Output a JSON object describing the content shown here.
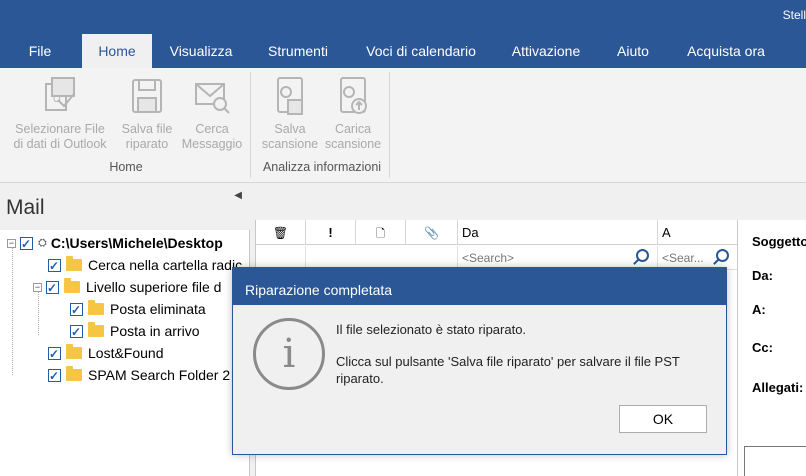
{
  "window": {
    "app_title": "Stell"
  },
  "tabs": [
    {
      "label": "File"
    },
    {
      "label": "Home"
    },
    {
      "label": "Visualizza"
    },
    {
      "label": "Strumenti"
    },
    {
      "label": "Voci di calendario"
    },
    {
      "label": "Attivazione"
    },
    {
      "label": "Aiuto"
    },
    {
      "label": "Acquista ora"
    }
  ],
  "ribbon": {
    "groups": [
      {
        "label": "Home",
        "buttons": [
          {
            "line1": "Selezionare File",
            "line2": "di dati di Outlook",
            "icon": "select-outlook-file-icon"
          },
          {
            "line1": "Salva file",
            "line2": "riparato",
            "icon": "save-file-icon"
          },
          {
            "line1": "Cerca",
            "line2": "Messaggio",
            "icon": "search-message-icon"
          }
        ]
      },
      {
        "label": "Analizza informazioni",
        "buttons": [
          {
            "line1": "Salva",
            "line2": "scansione",
            "icon": "save-scan-icon"
          },
          {
            "line1": "Carica",
            "line2": "scansione",
            "icon": "load-scan-icon"
          }
        ]
      }
    ]
  },
  "nav": {
    "title": "Mail",
    "tree": [
      {
        "label": "C:\\Users\\Michele\\Desktop"
      },
      {
        "label": "Cerca nella cartella radic"
      },
      {
        "label": "Livello superiore file d"
      },
      {
        "label": "Posta eliminata"
      },
      {
        "label": "Posta in arrivo"
      },
      {
        "label": "Lost&Found"
      },
      {
        "label": "SPAM Search Folder 2"
      }
    ]
  },
  "list": {
    "columns": {
      "from": "Da",
      "to": "A"
    },
    "search_placeholder_from": "<Search>",
    "search_placeholder_to": "<Sear..."
  },
  "preview": {
    "subject": "Soggetto",
    "from": "Da:",
    "to": "A:",
    "cc": "Cc:",
    "attachments": "Allegati:"
  },
  "dialog": {
    "title": "Riparazione completata",
    "line1": "Il file selezionato è stato riparato.",
    "line2a": "Clicca sul pulsante 'Salva file riparato' per salvare il file PST",
    "line2b": "riparato.",
    "ok_label": "OK"
  },
  "colors": {
    "accent": "#2b5797",
    "folder": "#f6c544"
  }
}
